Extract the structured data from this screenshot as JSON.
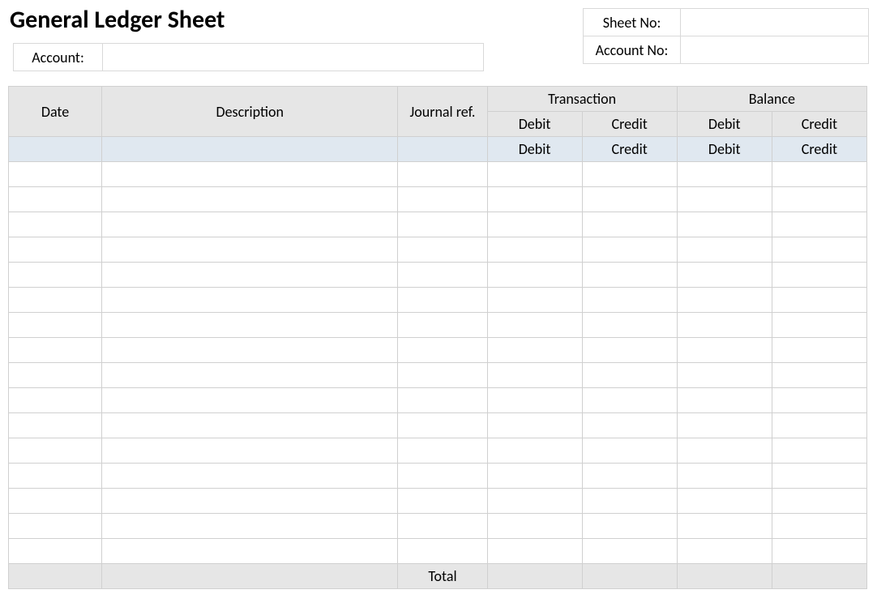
{
  "title": "General Ledger Sheet",
  "meta": {
    "account_label": "Account:",
    "account_value": "",
    "sheet_no_label": "Sheet No:",
    "sheet_no_value": "",
    "account_no_label": "Account No:",
    "account_no_value": ""
  },
  "headers": {
    "date": "Date",
    "description": "Description",
    "journal_ref": "Journal ref.",
    "transaction": "Transaction",
    "balance": "Balance",
    "debit": "Debit",
    "credit": "Credit",
    "total": "Total"
  },
  "rows": [
    {
      "date": "",
      "description": "",
      "journal_ref": "",
      "t_debit": "",
      "t_credit": "",
      "b_debit": "",
      "b_credit": ""
    },
    {
      "date": "",
      "description": "",
      "journal_ref": "",
      "t_debit": "",
      "t_credit": "",
      "b_debit": "",
      "b_credit": ""
    },
    {
      "date": "",
      "description": "",
      "journal_ref": "",
      "t_debit": "",
      "t_credit": "",
      "b_debit": "",
      "b_credit": ""
    },
    {
      "date": "",
      "description": "",
      "journal_ref": "",
      "t_debit": "",
      "t_credit": "",
      "b_debit": "",
      "b_credit": ""
    },
    {
      "date": "",
      "description": "",
      "journal_ref": "",
      "t_debit": "",
      "t_credit": "",
      "b_debit": "",
      "b_credit": ""
    },
    {
      "date": "",
      "description": "",
      "journal_ref": "",
      "t_debit": "",
      "t_credit": "",
      "b_debit": "",
      "b_credit": ""
    },
    {
      "date": "",
      "description": "",
      "journal_ref": "",
      "t_debit": "",
      "t_credit": "",
      "b_debit": "",
      "b_credit": ""
    },
    {
      "date": "",
      "description": "",
      "journal_ref": "",
      "t_debit": "",
      "t_credit": "",
      "b_debit": "",
      "b_credit": ""
    },
    {
      "date": "",
      "description": "",
      "journal_ref": "",
      "t_debit": "",
      "t_credit": "",
      "b_debit": "",
      "b_credit": ""
    },
    {
      "date": "",
      "description": "",
      "journal_ref": "",
      "t_debit": "",
      "t_credit": "",
      "b_debit": "",
      "b_credit": ""
    },
    {
      "date": "",
      "description": "",
      "journal_ref": "",
      "t_debit": "",
      "t_credit": "",
      "b_debit": "",
      "b_credit": ""
    },
    {
      "date": "",
      "description": "",
      "journal_ref": "",
      "t_debit": "",
      "t_credit": "",
      "b_debit": "",
      "b_credit": ""
    },
    {
      "date": "",
      "description": "",
      "journal_ref": "",
      "t_debit": "",
      "t_credit": "",
      "b_debit": "",
      "b_credit": ""
    },
    {
      "date": "",
      "description": "",
      "journal_ref": "",
      "t_debit": "",
      "t_credit": "",
      "b_debit": "",
      "b_credit": ""
    },
    {
      "date": "",
      "description": "",
      "journal_ref": "",
      "t_debit": "",
      "t_credit": "",
      "b_debit": "",
      "b_credit": ""
    },
    {
      "date": "",
      "description": "",
      "journal_ref": "",
      "t_debit": "",
      "t_credit": "",
      "b_debit": "",
      "b_credit": ""
    }
  ],
  "totals": {
    "t_debit": "",
    "t_credit": "",
    "b_debit": "",
    "b_credit": ""
  }
}
